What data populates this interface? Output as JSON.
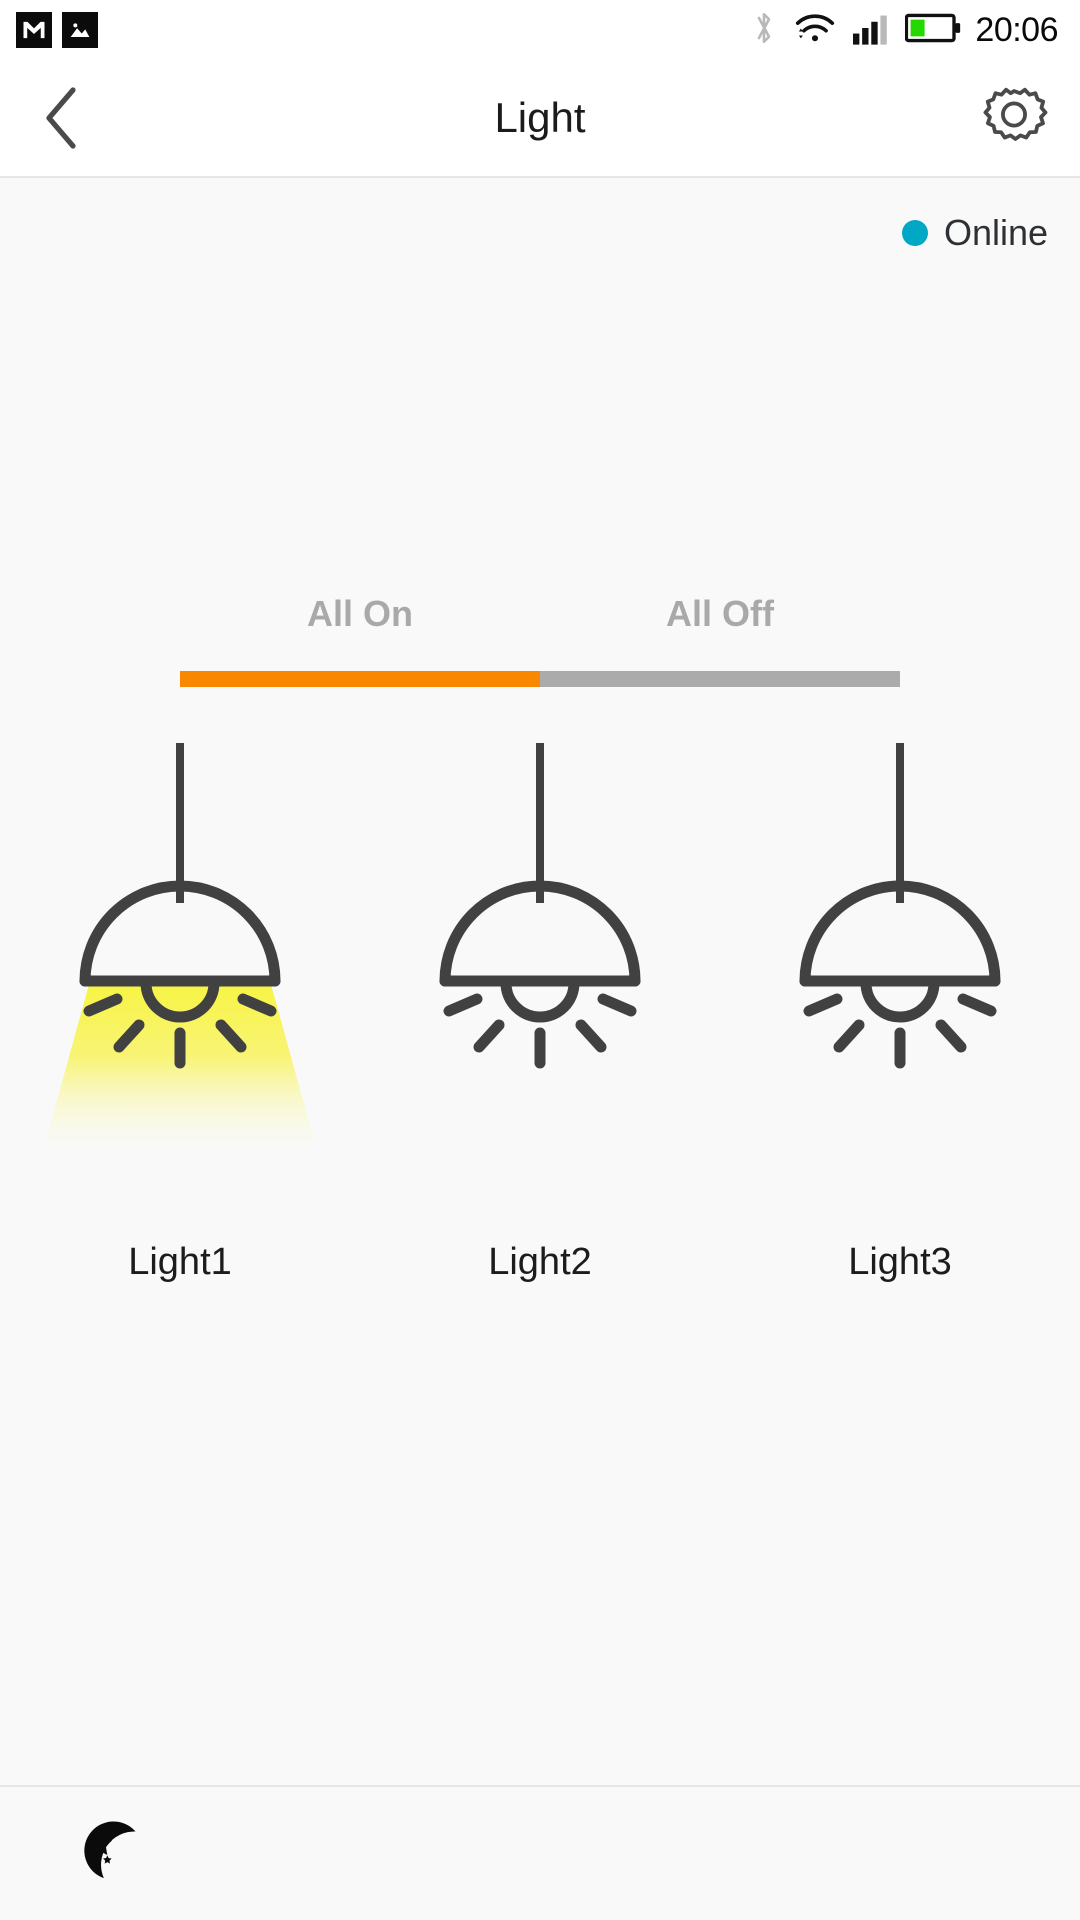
{
  "statusbar": {
    "notifications": [
      {
        "icon": "gmail-icon",
        "label": "M"
      },
      {
        "icon": "photos-icon",
        "label": "image"
      }
    ],
    "bluetooth_icon": "bluetooth-icon",
    "wifi_icon": "wifi-icon",
    "signal_icon": "cellular-signal-icon",
    "battery_icon": "battery-icon",
    "battery_level_percent": 35,
    "time": "20:06"
  },
  "appbar": {
    "back_icon": "back-chevron-icon",
    "title": "Light",
    "settings_icon": "gear-icon"
  },
  "device": {
    "status_text": "Online",
    "status_color": "#00a8c6"
  },
  "tabs": {
    "active_index": 0,
    "items": [
      {
        "label": "All On",
        "active": true,
        "bar_color": "#f98700"
      },
      {
        "label": "All Off",
        "active": false,
        "bar_color": "#ababab"
      }
    ]
  },
  "lights": [
    {
      "name": "Light1",
      "on": true,
      "icon": "pendant-lamp-icon"
    },
    {
      "name": "Light2",
      "on": false,
      "icon": "pendant-lamp-icon"
    },
    {
      "name": "Light3",
      "on": false,
      "icon": "pendant-lamp-icon"
    }
  ],
  "bottombar": {
    "night_mode_icon": "moon-stars-icon"
  },
  "colors": {
    "accent_orange": "#f98700",
    "inactive_gray": "#ababab",
    "online_cyan": "#00a8c6",
    "glow_yellow": "#f7f442",
    "icon_stroke": "#414141",
    "content_bg": "#f9f9f9"
  }
}
